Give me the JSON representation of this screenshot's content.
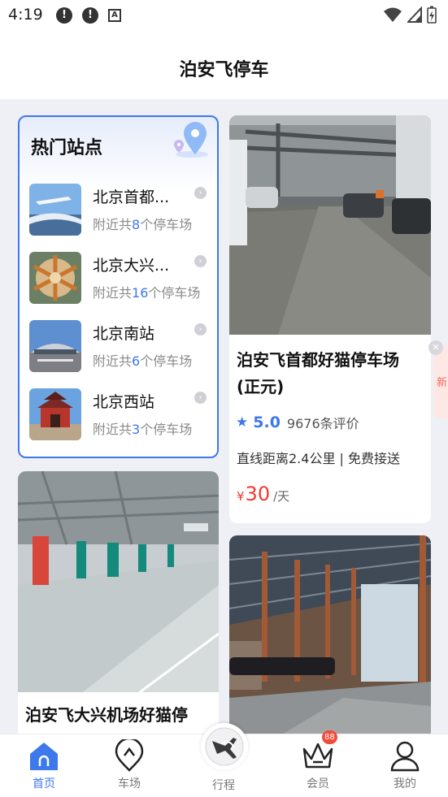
{
  "status_bar": {
    "time": "4:19",
    "notif_icons": [
      "!",
      "!"
    ],
    "a_icon": "A"
  },
  "header": {
    "title": "泊安飞停车"
  },
  "hot_stations": {
    "title": "热门站点",
    "items": [
      {
        "name": "北京首都...",
        "prefix": "附近共",
        "count": "8",
        "suffix": "个停车场",
        "icon": "airport-thumbnail"
      },
      {
        "name": "北京大兴...",
        "prefix": "附近共",
        "count": "16",
        "suffix": "个停车场",
        "icon": "daxing-thumbnail"
      },
      {
        "name": "北京南站",
        "prefix": "附近共",
        "count": "6",
        "suffix": "个停车场",
        "icon": "south-station-thumbnail"
      },
      {
        "name": "北京西站",
        "prefix": "附近共",
        "count": "3",
        "suffix": "个停车场",
        "icon": "west-station-thumbnail"
      }
    ]
  },
  "lots": [
    {
      "name": "泊安飞首都好猫停车场(正元)",
      "name_line1": "泊安飞首都好猫停车场",
      "name_line2": "(正元)",
      "rating": "5.0",
      "reviews": "9676条评价",
      "desc": "直线距离2.4公里 | 免费接送",
      "currency": "¥",
      "price": "30",
      "unit": "/天"
    },
    {
      "name_line1": "泊安飞大兴机场好猫停"
    }
  ],
  "side_float": {
    "text": "新"
  },
  "tabs": [
    {
      "label": "首页",
      "icon": "home-icon",
      "active": true
    },
    {
      "label": "车场",
      "icon": "location-pin-icon",
      "active": false
    },
    {
      "label": "行程",
      "icon": "trip-plane-icon",
      "active": false
    },
    {
      "label": "会员",
      "icon": "crown-icon",
      "active": false,
      "badge": "88"
    },
    {
      "label": "我的",
      "icon": "user-icon",
      "active": false
    }
  ],
  "colors": {
    "accent": "#3d78ec",
    "price": "#f03b2f",
    "background": "#eff0f6"
  }
}
